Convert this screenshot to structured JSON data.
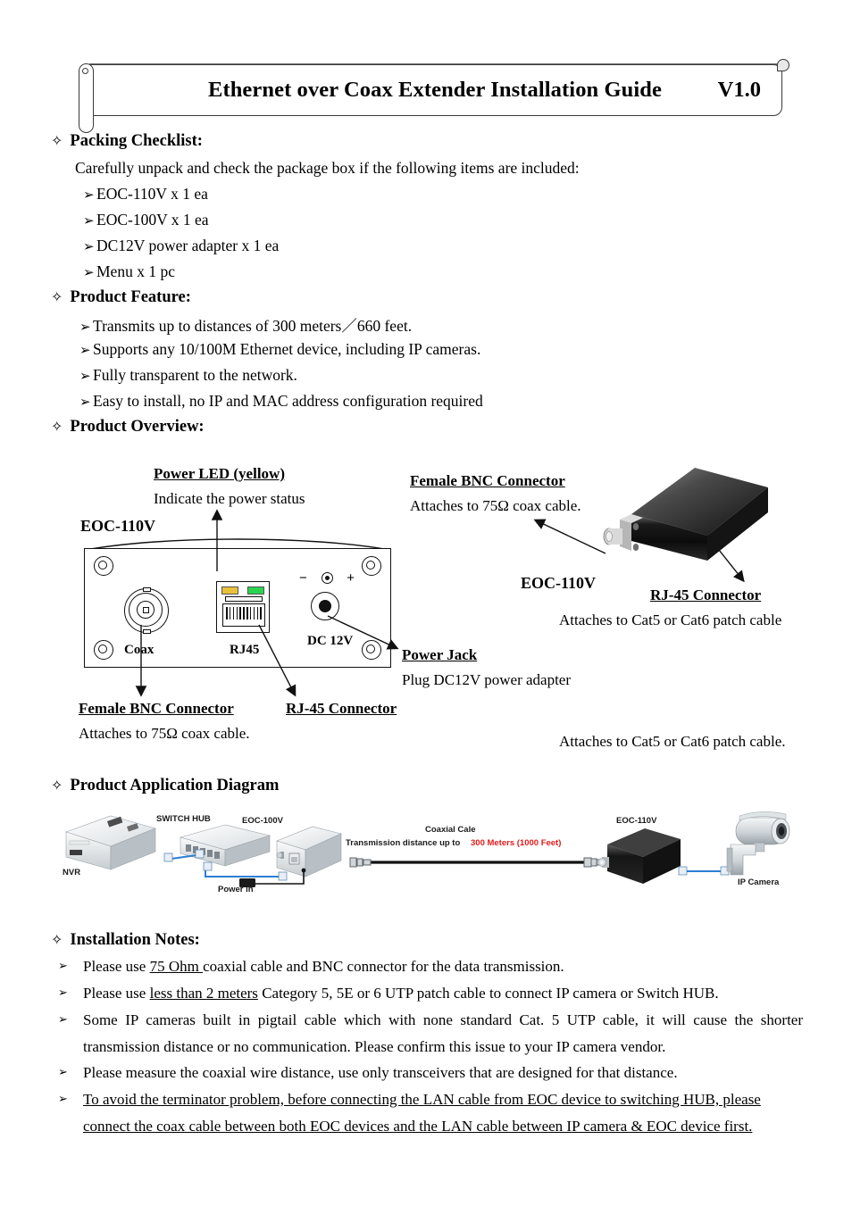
{
  "header": {
    "title": "Ethernet over Coax Extender Installation Guide",
    "version": "V1.0"
  },
  "sections": {
    "packing": {
      "heading": "Packing Checklist:",
      "intro": "Carefully unpack and check the package box if the following items are included:",
      "items": [
        "EOC-110V x 1 ea",
        "EOC-100V x 1 ea",
        "DC12V power adapter x 1 ea",
        "Menu x 1 pc"
      ]
    },
    "feature": {
      "heading": "Product Feature:",
      "items": [
        "Transmits up to distances of 300 meters／660 feet.",
        "Supports any 10/100M Ethernet device, including IP cameras.",
        "Fully transparent to the network.",
        "Easy to install, no IP and MAC address configuration required"
      ]
    },
    "overview": {
      "heading": "Product Overview:",
      "device_name_left": "EOC-110V",
      "device_name_right": "EOC-110V",
      "callouts": {
        "power_led_title": "Power LED (yellow)",
        "power_led_desc": "Indicate the power status",
        "bnc_top_title": "Female BNC Connector",
        "bnc_top_desc": "Attaches to 75Ω  coax cable.",
        "rj45_right_title": "RJ-45 Connector",
        "rj45_right_desc": "Attaches to Cat5 or Cat6 patch cable",
        "power_jack_title": "Power Jack",
        "power_jack_desc": "Plug DC12V power adapter",
        "bnc_bottom_title": "Female BNC Connector",
        "bnc_bottom_desc": "Attaches to 75Ω  coax cable.",
        "rj45_bottom_title": "RJ-45 Connector",
        "rj45_bottom_desc": "Attaches to Cat5 or Cat6 patch cable."
      },
      "port_labels": {
        "coax": "Coax",
        "rj45": "RJ45",
        "dc": "DC 12V",
        "polarity_minus": "−",
        "polarity_plus": "+"
      }
    },
    "application": {
      "heading": "Product Application Diagram",
      "labels": {
        "nvr": "NVR",
        "switch_hub": "SWITCH HUB",
        "eoc100": "EOC-100V",
        "power_in": "Power in",
        "coax_cable": "Coaxial Cale",
        "distance_prefix": "Transmission distance up to",
        "distance_value": "300 Meters (1000 Feet)",
        "eoc110": "EOC-110V",
        "ip_camera": "IP Camera"
      },
      "colors": {
        "distance_red": "#e01b1b",
        "lan_cable_blue": "#2b7fd4"
      }
    },
    "notes": {
      "heading": "Installation Notes:",
      "items": [
        {
          "pre": "Please use ",
          "underline": "75 Ohm ",
          "post": "coaxial cable and BNC connector for the data transmission."
        },
        {
          "pre": "Please use ",
          "underline": "less than 2 meters",
          "post": " Category 5, 5E or 6 UTP patch cable to connect IP camera or Switch HUB."
        },
        {
          "pre": "",
          "underline": "",
          "post": "Some IP cameras built in pigtail cable which with none standard Cat. 5 UTP cable, it will cause the shorter"
        },
        {
          "pre": "",
          "underline": "",
          "post": "Please measure the coaxial wire distance, use only transceivers that are designed for that distance."
        }
      ],
      "item3_cont": "transmission distance or no communication.    Please confirm this issue to your IP camera vendor.",
      "item5_line1": "To avoid the terminator problem, before connecting the LAN cable from EOC device to switching HUB, please",
      "item5_line2": "connect the coax cable between both EOC devices and the LAN cable between IP camera & EOC device first."
    }
  },
  "glyphs": {
    "diamond": "✧",
    "arrow_solid": "➢",
    "arrow_thin": "➢"
  }
}
